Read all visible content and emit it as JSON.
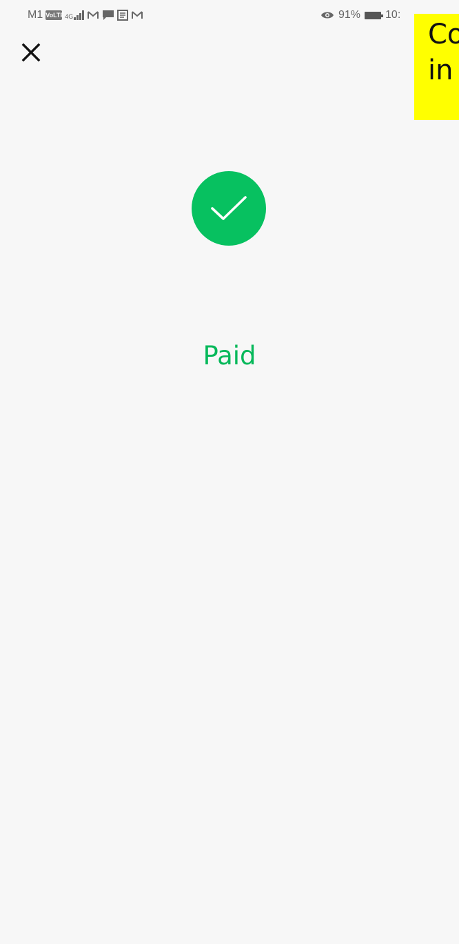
{
  "status_bar": {
    "carrier": "M1",
    "volte": "VoLTE",
    "network": "4G",
    "notification_icons": [
      "gmail-icon",
      "chat-icon",
      "message-icon",
      "gmail-icon"
    ],
    "battery_percent": "91%",
    "time": "10:",
    "eye_icon": "eye-icon",
    "battery_icon": "battery-icon"
  },
  "overlay": {
    "line1": "Co",
    "line2": "in",
    "color": "#ffff00"
  },
  "header": {
    "close_icon": "close-icon"
  },
  "result": {
    "icon": "checkmark-icon",
    "icon_color": "#07c160",
    "title": "Paid",
    "title_color": "#06b85a"
  },
  "theme": {
    "background": "#f7f7f7"
  }
}
